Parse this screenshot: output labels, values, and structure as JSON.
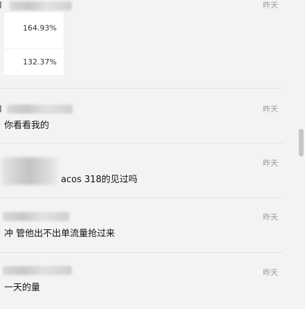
{
  "messages": [
    {
      "time": "昨天",
      "values": [
        "164.93%",
        "132.37%"
      ]
    },
    {
      "time": "昨天",
      "text": "你看看我的"
    },
    {
      "time": "昨天",
      "text": "acos 318的见过吗"
    },
    {
      "time": "昨天",
      "text": "冲 管他出不出单流量抢过来"
    },
    {
      "time": "昨天",
      "text": "一天的量"
    }
  ]
}
